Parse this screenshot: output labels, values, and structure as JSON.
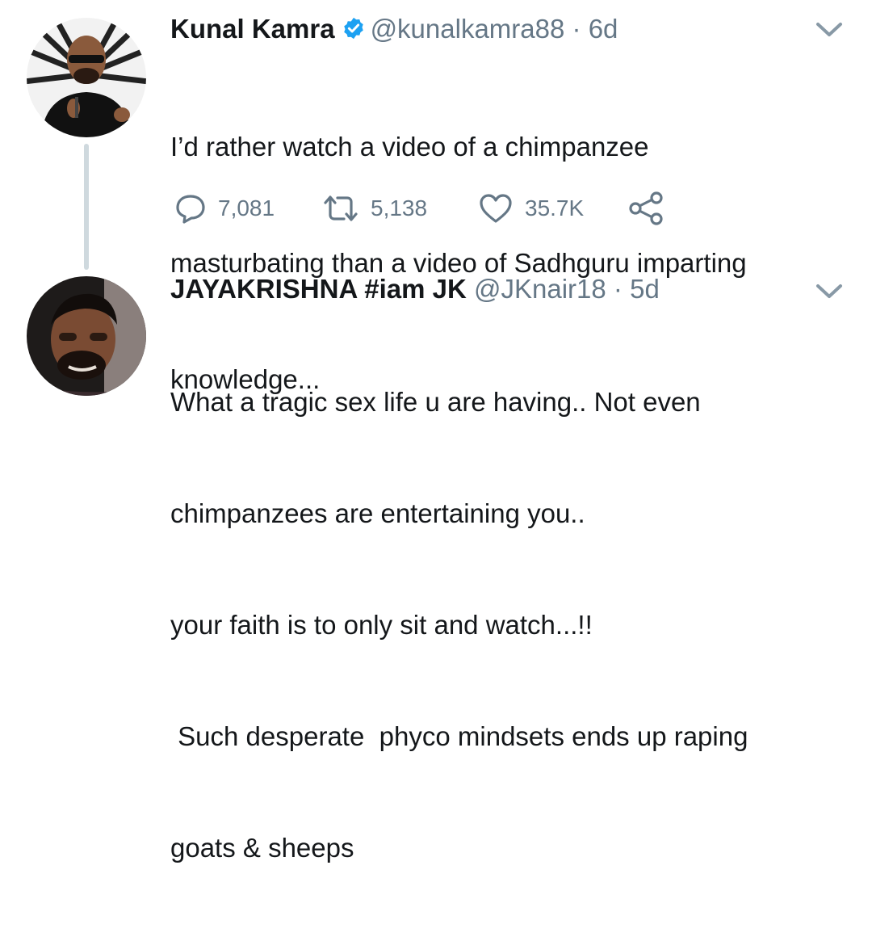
{
  "tweets": [
    {
      "name": "Kunal Kamra",
      "verified": true,
      "handle": "@kunalkamra88",
      "separator": "·",
      "time": "6d",
      "lines": [
        "I’d rather watch a video of a chimpanzee",
        "masturbating than a video of Sadhguru imparting",
        "knowledge..."
      ],
      "actions": {
        "replies": "7,081",
        "retweets": "5,138",
        "likes": "35.7K"
      }
    },
    {
      "name": "JAYAKRISHNA #iam JK",
      "verified": false,
      "handle": "@JKnair18",
      "separator": "·",
      "time": "5d",
      "lines": [
        "What a tragic sex life u are having.. Not even",
        "chimpanzees are entertaining you..",
        "your faith is to only sit and watch...!!",
        " Such desperate  phyco mindsets ends up raping",
        "goats & sheeps"
      ]
    }
  ],
  "colors": {
    "text": "#14171a",
    "secondary": "#657786",
    "verified": "#1da1f2",
    "thread_line": "#cfd9de"
  },
  "icons": [
    "verified-badge-icon",
    "chevron-down-icon",
    "reply-icon",
    "retweet-icon",
    "like-icon",
    "share-icon"
  ]
}
